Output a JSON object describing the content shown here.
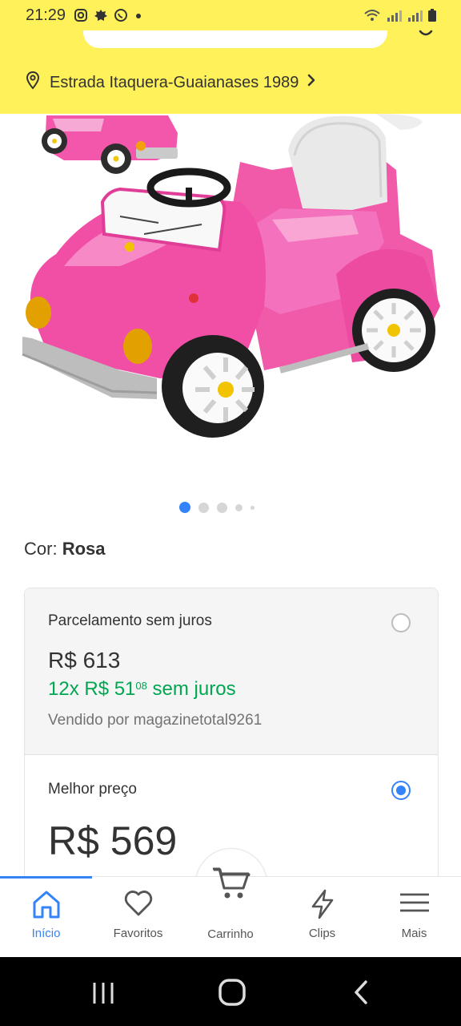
{
  "status_bar": {
    "time": "21:29",
    "left_icons": [
      "instagram-icon",
      "settings-icon",
      "whatsapp-icon",
      "dot-icon"
    ],
    "right_icons": [
      "wifi-icon",
      "signal-icon",
      "signal-icon",
      "battery-icon"
    ]
  },
  "header": {
    "background": "#fff159",
    "address": "Estrada Itaquera-Guaianases 1989"
  },
  "product": {
    "image": "pink-ride-on-car",
    "carousel": {
      "count": 5,
      "active_index": 0
    }
  },
  "color": {
    "label": "Cor:",
    "value": "Rosa"
  },
  "purchase_options": [
    {
      "title": "Parcelamento sem juros",
      "price": "R$ 613",
      "installments_prefix": "12x R$ 51",
      "installments_cents": "08",
      "installments_suffix": "sem juros",
      "seller": "Vendido por magazinetotal9261",
      "selected": false
    },
    {
      "title": "Melhor preço",
      "price": "R$ 569",
      "selected": true
    }
  ],
  "tabs": [
    {
      "label": "Início",
      "icon": "home-icon",
      "active": true
    },
    {
      "label": "Favoritos",
      "icon": "heart-icon",
      "active": false
    },
    {
      "label": "Carrinho",
      "icon": "cart-icon",
      "active": false
    },
    {
      "label": "Clips",
      "icon": "lightning-icon",
      "active": false
    },
    {
      "label": "Mais",
      "icon": "menu-icon",
      "active": false
    }
  ],
  "colors": {
    "accent": "#3483fa",
    "success": "#00a650",
    "header": "#fff159"
  }
}
